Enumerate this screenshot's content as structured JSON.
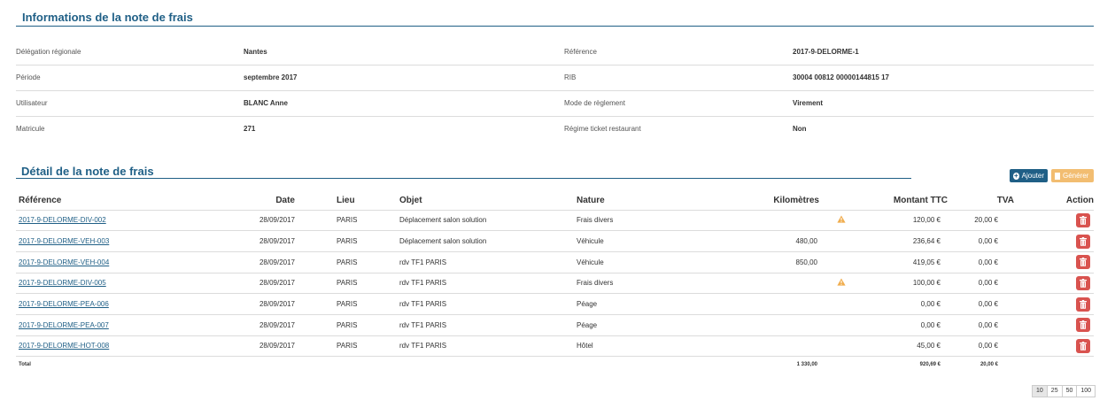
{
  "info": {
    "title": "Informations de la note de frais",
    "rows": [
      {
        "l1": "Délégation régionale",
        "v1": "Nantes",
        "l2": "Référence",
        "v2": "2017-9-DELORME-1"
      },
      {
        "l1": "Période",
        "v1": "septembre 2017",
        "l2": "RIB",
        "v2": "30004 00812 00000144815 17"
      },
      {
        "l1": "Utilisateur",
        "v1": "BLANC Anne",
        "l2": "Mode de règlement",
        "v2": "Virement"
      },
      {
        "l1": "Matricule",
        "v1": "271",
        "l2": "Régime ticket restaurant",
        "v2": "Non"
      }
    ]
  },
  "detail": {
    "title": "Détail de la note de frais",
    "add_label": "Ajouter",
    "generate_label": "Générer",
    "columns": {
      "reference": "Référence",
      "date": "Date",
      "lieu": "Lieu",
      "objet": "Objet",
      "nature": "Nature",
      "km": "Kilomètres",
      "ttc": "Montant TTC",
      "tva": "TVA",
      "action": "Action"
    },
    "rows": [
      {
        "ref": "2017-9-DELORME-DIV-002",
        "date": "28/09/2017",
        "lieu": "PARIS",
        "objet": "Déplacement salon solution",
        "nature": "Frais divers",
        "km": "",
        "warn": true,
        "ttc": "120,00 €",
        "tva": "20,00 €"
      },
      {
        "ref": "2017-9-DELORME-VEH-003",
        "date": "28/09/2017",
        "lieu": "PARIS",
        "objet": "Déplacement salon solution",
        "nature": "Véhicule",
        "km": "480,00",
        "warn": false,
        "ttc": "236,64 €",
        "tva": "0,00 €"
      },
      {
        "ref": "2017-9-DELORME-VEH-004",
        "date": "28/09/2017",
        "lieu": "PARIS",
        "objet": "rdv TF1 PARIS",
        "nature": "Véhicule",
        "km": "850,00",
        "warn": false,
        "ttc": "419,05 €",
        "tva": "0,00 €"
      },
      {
        "ref": "2017-9-DELORME-DIV-005",
        "date": "28/09/2017",
        "lieu": "PARIS",
        "objet": "rdv TF1 PARIS",
        "nature": "Frais divers",
        "km": "",
        "warn": true,
        "ttc": "100,00 €",
        "tva": "0,00 €"
      },
      {
        "ref": "2017-9-DELORME-PEA-006",
        "date": "28/09/2017",
        "lieu": "PARIS",
        "objet": "rdv TF1 PARIS",
        "nature": "Péage",
        "km": "",
        "warn": false,
        "ttc": "0,00 €",
        "tva": "0,00 €"
      },
      {
        "ref": "2017-9-DELORME-PEA-007",
        "date": "28/09/2017",
        "lieu": "PARIS",
        "objet": "rdv TF1 PARIS",
        "nature": "Péage",
        "km": "",
        "warn": false,
        "ttc": "0,00 €",
        "tva": "0,00 €"
      },
      {
        "ref": "2017-9-DELORME-HOT-008",
        "date": "28/09/2017",
        "lieu": "PARIS",
        "objet": "rdv TF1 PARIS",
        "nature": "Hôtel",
        "km": "",
        "warn": false,
        "ttc": "45,00 €",
        "tva": "0,00 €"
      }
    ],
    "total": {
      "label": "Total",
      "km": "1 330,00",
      "ttc": "920,69 €",
      "tva": "20,00 €"
    }
  },
  "pager": {
    "sizes": [
      "10",
      "25",
      "50",
      "100"
    ],
    "selected": "10"
  },
  "colors": {
    "accent": "#1f5f86",
    "danger": "#d9534f",
    "warning": "#f0ad4e"
  }
}
